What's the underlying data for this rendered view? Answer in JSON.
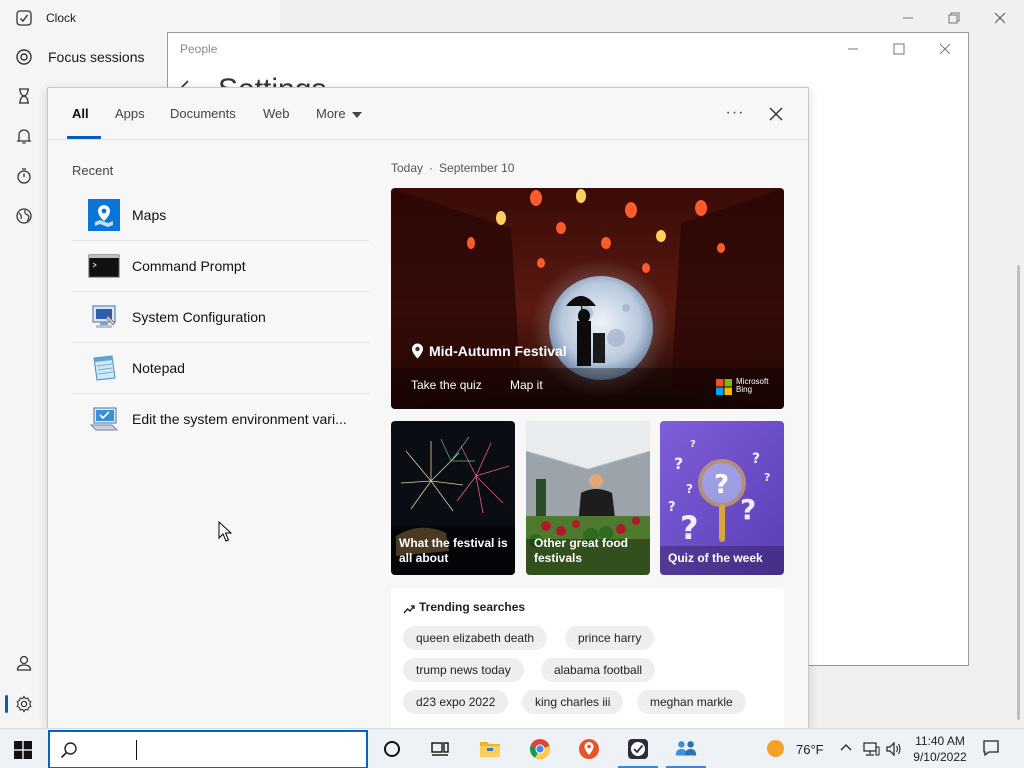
{
  "clock_app": {
    "title": "Clock",
    "nav": {
      "focus_sessions_label": "Focus sessions"
    }
  },
  "people_window": {
    "title": "People",
    "heading": "Settings"
  },
  "search": {
    "tabs": [
      {
        "label": "All",
        "active": true
      },
      {
        "label": "Apps"
      },
      {
        "label": "Documents"
      },
      {
        "label": "Web"
      },
      {
        "label": "More"
      }
    ],
    "recent_label": "Recent",
    "recent_items": [
      {
        "label": "Maps",
        "icon": "maps-icon"
      },
      {
        "label": "Command Prompt",
        "icon": "command-prompt-icon"
      },
      {
        "label": "System Configuration",
        "icon": "system-configuration-icon"
      },
      {
        "label": "Notepad",
        "icon": "notepad-icon"
      },
      {
        "label": "Edit the system environment vari...",
        "icon": "system-properties-icon"
      }
    ],
    "today_label": "Today",
    "today_date": "September 10",
    "hero": {
      "title": "Mid-Autumn Festival",
      "link1": "Take the quiz",
      "link2": "Map it",
      "brand_line1": "Microsoft",
      "brand_line2": "Bing"
    },
    "cards": [
      {
        "label": "What the festival is all about"
      },
      {
        "label": "Other great food festivals"
      },
      {
        "label": "Quiz of the week"
      }
    ],
    "trending_title": "Trending searches",
    "trending": [
      "queen elizabeth death",
      "prince harry",
      "trump news today",
      "alabama football",
      "d23 expo 2022",
      "king charles iii",
      "meghan markle"
    ]
  },
  "taskbar": {
    "search_value": "",
    "weather_temp": "76°F",
    "time": "11:40 AM",
    "date": "9/10/2022"
  },
  "colors": {
    "accent": "#005fb8",
    "taskbar_bg": "#eef1f5"
  }
}
